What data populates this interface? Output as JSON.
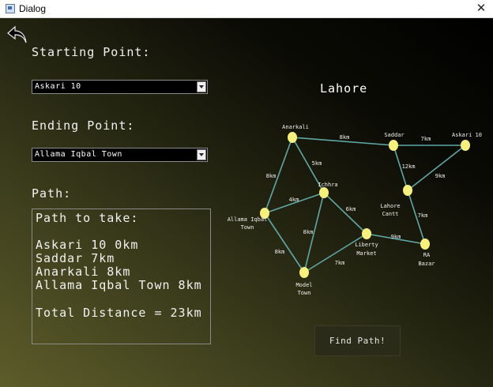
{
  "window": {
    "title": "Dialog",
    "close_glyph": "✕"
  },
  "form": {
    "start_label": "Starting Point:",
    "start_value": "Askari 10",
    "end_label": "Ending Point:",
    "end_value": "Allama Iqbal Town",
    "path_label": "Path:"
  },
  "path_result": {
    "lines": [
      "Path to take:",
      "",
      "Askari 10 0km",
      "Saddar 7km",
      "Anarkali 8km",
      "Allama Iqbal Town 8km",
      "",
      "Total Distance = 23km"
    ]
  },
  "map": {
    "title": "Lahore",
    "node_color": "#f7f07a",
    "edge_color": "#5fa8a8",
    "nodes": [
      {
        "id": "anarkali",
        "label": [
          "Anarkali"
        ]
      },
      {
        "id": "saddar",
        "label": [
          "Saddar"
        ]
      },
      {
        "id": "askari10",
        "label": [
          "Askari 10"
        ]
      },
      {
        "id": "ichhra",
        "label": [
          "Ichhra"
        ]
      },
      {
        "id": "lahore_cantt",
        "label": [
          "Lahore",
          "Cantt"
        ]
      },
      {
        "id": "allama_iqbal",
        "label": [
          "Allama Iqbal",
          "Town"
        ]
      },
      {
        "id": "liberty",
        "label": [
          "Liberty",
          "Market"
        ]
      },
      {
        "id": "ra_bazar",
        "label": [
          "RA",
          "Bazar"
        ]
      },
      {
        "id": "model_town",
        "label": [
          "Model",
          "Town"
        ]
      }
    ],
    "edges": [
      {
        "from": "anarkali",
        "to": "saddar",
        "label": "8km"
      },
      {
        "from": "saddar",
        "to": "askari10",
        "label": "7km"
      },
      {
        "from": "anarkali",
        "to": "ichhra",
        "label": "5km"
      },
      {
        "from": "anarkali",
        "to": "allama_iqbal",
        "label": "8km"
      },
      {
        "from": "saddar",
        "to": "lahore_cantt",
        "label": "12km"
      },
      {
        "from": "askari10",
        "to": "lahore_cantt",
        "label": "9km"
      },
      {
        "from": "ichhra",
        "to": "allama_iqbal",
        "label": "4km"
      },
      {
        "from": "ichhra",
        "to": "liberty",
        "label": "6km"
      },
      {
        "from": "ichhra",
        "to": "model_town",
        "label": "8km"
      },
      {
        "from": "allama_iqbal",
        "to": "model_town",
        "label": "8km"
      },
      {
        "from": "model_town",
        "to": "liberty",
        "label": "7km"
      },
      {
        "from": "liberty",
        "to": "ra_bazar",
        "label": "9km"
      },
      {
        "from": "lahore_cantt",
        "to": "ra_bazar",
        "label": "7km"
      }
    ]
  },
  "find_button": {
    "label": "Find Path!"
  },
  "icons": {
    "back": "back-arrow-icon",
    "close": "close-icon"
  }
}
